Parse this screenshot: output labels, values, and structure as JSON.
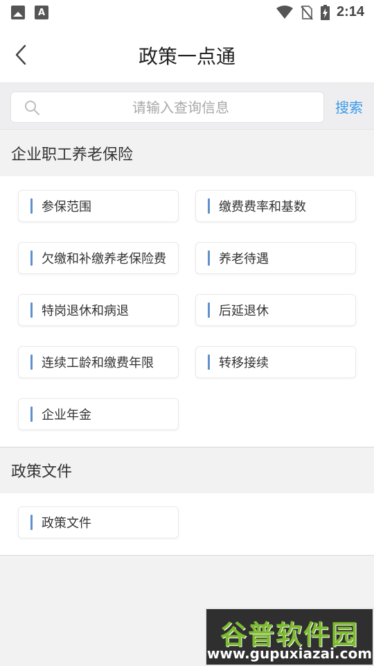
{
  "status_bar": {
    "time": "2:14",
    "icons": [
      "image-icon",
      "font-icon",
      "wifi-icon",
      "no-sim-icon",
      "battery-charging-icon"
    ]
  },
  "header": {
    "title": "政策一点通",
    "back_icon": "chevron-left-icon"
  },
  "search": {
    "placeholder": "请输入查询信息",
    "value": "",
    "button_label": "搜索",
    "icon": "search-icon"
  },
  "sections": [
    {
      "title": "企业职工养老保险",
      "items": [
        {
          "label": "参保范围"
        },
        {
          "label": "缴费费率和基数"
        },
        {
          "label": "欠缴和补缴养老保险费"
        },
        {
          "label": "养老待遇"
        },
        {
          "label": "特岗退休和病退"
        },
        {
          "label": "后延退休"
        },
        {
          "label": "连续工龄和缴费年限"
        },
        {
          "label": "转移接续"
        },
        {
          "label": "企业年金"
        }
      ]
    },
    {
      "title": "政策文件",
      "items": [
        {
          "label": "政策文件"
        }
      ]
    }
  ],
  "watermark": {
    "line1": "谷普软件园",
    "line2": "www.gupuxiazai.com"
  },
  "colors": {
    "accent": "#3a9be8",
    "card_bar": "#5f8fcc",
    "background": "#f2f2f2"
  }
}
